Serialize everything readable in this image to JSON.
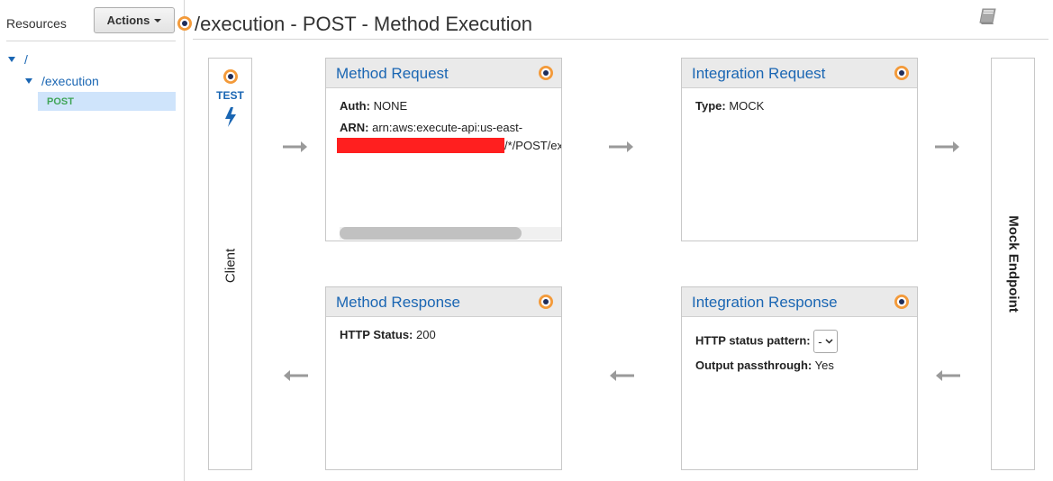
{
  "sidebar": {
    "title": "Resources",
    "actions_label": "Actions",
    "tree": {
      "root": "/",
      "child": "/execution",
      "method": "POST"
    }
  },
  "header": {
    "title": "/execution - POST - Method Execution",
    "book_icon": "book-icon"
  },
  "client": {
    "test_label": "TEST",
    "label": "Client"
  },
  "endpoint": {
    "label": "Mock Endpoint"
  },
  "method_request": {
    "title": "Method Request",
    "auth_label": "Auth:",
    "auth_value": "NONE",
    "arn_label": "ARN:",
    "arn_value_line1": "arn:aws:execute-api:us-east-",
    "arn_value_line2_suffix": "/*/POST/ex"
  },
  "integration_request": {
    "title": "Integration Request",
    "type_label": "Type:",
    "type_value": "MOCK"
  },
  "method_response": {
    "title": "Method Response",
    "status_label": "HTTP Status:",
    "status_value": "200"
  },
  "integration_response": {
    "title": "Integration Response",
    "pattern_label": "HTTP status pattern:",
    "pattern_value": "-",
    "passthrough_label": "Output passthrough:",
    "passthrough_value": "Yes"
  },
  "colors": {
    "link": "#1a66b3",
    "post_badge": "#41a558",
    "selected_bg": "#cfe4fb",
    "info_dot_orange": "#f39a3a",
    "redaction": "#ff1f1f",
    "arrow": "#9a9a9a"
  }
}
